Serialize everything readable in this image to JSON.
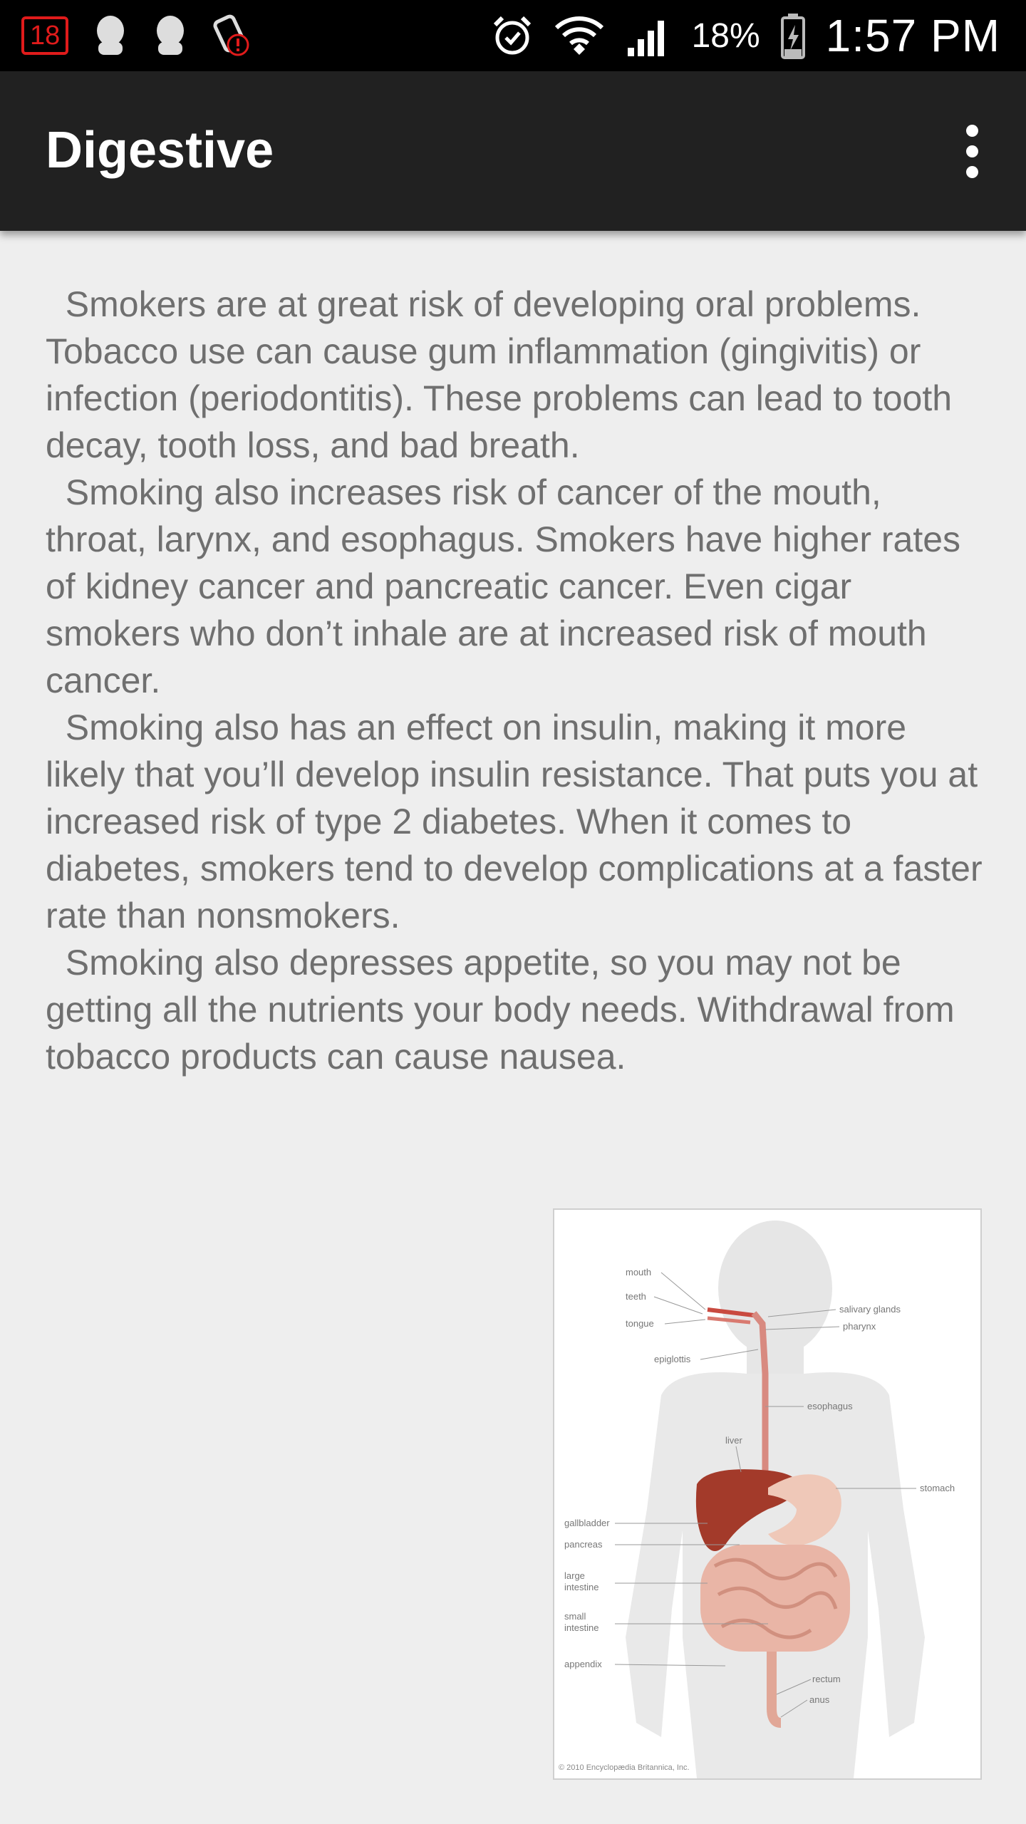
{
  "status_bar": {
    "notification_badge": "18",
    "battery_percent": "18%",
    "time": "1:57 PM",
    "icons": [
      "calendar-badge-icon",
      "user-avatar-icon",
      "user-avatar-icon",
      "app-alert-icon",
      "alarm-icon",
      "wifi-icon",
      "cell-signal-icon",
      "battery-icon"
    ]
  },
  "app_bar": {
    "title": "Digestive",
    "menu_icon": "overflow-menu-icon"
  },
  "article": {
    "paragraphs": [
      "  Smokers are at great risk of developing oral problems. Tobacco use can cause gum inflammation (gingivitis) or infection (periodontitis). These problems can lead to tooth decay, tooth loss, and bad breath.",
      "  Smoking also increases risk of cancer of the mouth, throat, larynx, and esophagus. Smokers have higher rates of kidney cancer and pancreatic cancer. Even cigar smokers who don’t inhale are at increased risk of mouth cancer.",
      "  Smoking also has an effect on insulin, making it more likely that you’ll develop insulin resistance. That puts you at increased risk of type 2 diabetes. When it comes to diabetes, smokers tend to develop complications at a faster rate than nonsmokers.",
      "  Smoking also depresses appetite, so you may not be getting all the nutrients your body needs. Withdrawal from tobacco products can cause nausea."
    ]
  },
  "figure": {
    "labels": {
      "mouth": "mouth",
      "teeth": "teeth",
      "tongue": "tongue",
      "epiglottis": "epiglottis",
      "salivary_glands": "salivary glands",
      "pharynx": "pharynx",
      "esophagus": "esophagus",
      "liver": "liver",
      "stomach": "stomach",
      "gallbladder": "gallbladder",
      "pancreas": "pancreas",
      "large_intestine_1": "large",
      "large_intestine_2": "intestine",
      "small_intestine_1": "small",
      "small_intestine_2": "intestine",
      "appendix": "appendix",
      "rectum": "rectum",
      "anus": "anus"
    },
    "credit": "© 2010 Encyclopædia Britannica, Inc."
  },
  "colors": {
    "status_bar_bg": "#000000",
    "app_bar_bg": "#212121",
    "page_bg": "#eeeeee",
    "body_text": "#6f6f6f",
    "badge_red": "#e01b1b",
    "liver": "#a33a2a",
    "intestine": "#e9b5a6"
  }
}
